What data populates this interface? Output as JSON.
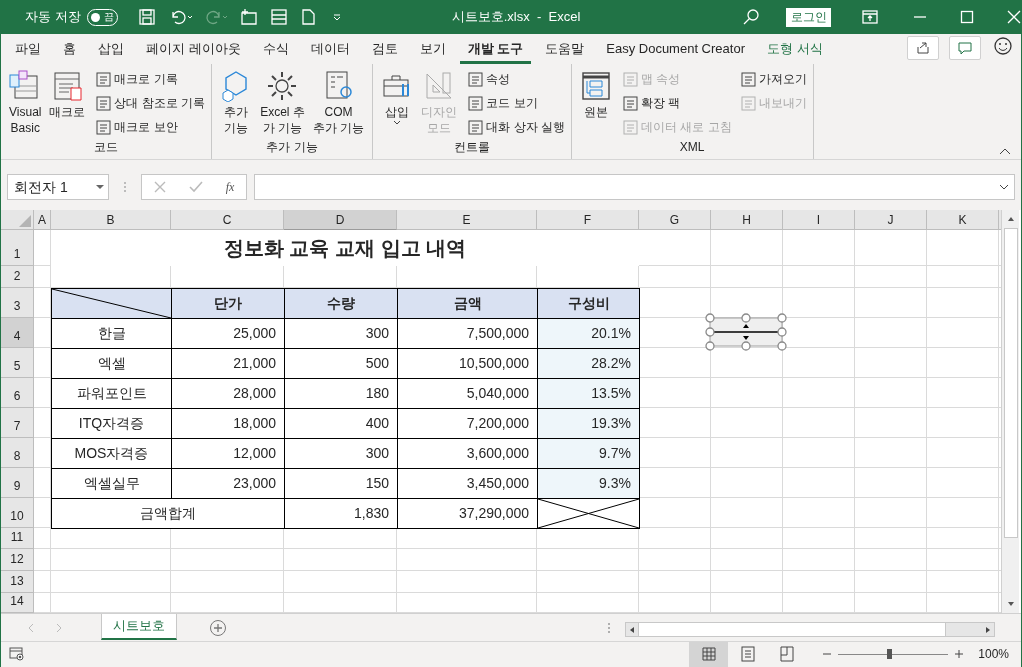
{
  "title_bar": {
    "autosave_label": "자동 저장",
    "autosave": {
      "on": false,
      "label": "끔"
    },
    "title": "시트보호.xlsx  -  Excel",
    "login_button": "로그인"
  },
  "ribbon_tabs": [
    {
      "label": "파일",
      "selected": false,
      "kind": "normal"
    },
    {
      "label": "홈",
      "selected": false,
      "kind": "normal"
    },
    {
      "label": "삽입",
      "selected": false,
      "kind": "normal"
    },
    {
      "label": "페이지 레이아웃",
      "selected": false,
      "kind": "normal"
    },
    {
      "label": "수식",
      "selected": false,
      "kind": "normal"
    },
    {
      "label": "데이터",
      "selected": false,
      "kind": "normal"
    },
    {
      "label": "검토",
      "selected": false,
      "kind": "normal"
    },
    {
      "label": "보기",
      "selected": false,
      "kind": "normal"
    },
    {
      "label": "개발 도구",
      "selected": true,
      "kind": "normal"
    },
    {
      "label": "도움말",
      "selected": false,
      "kind": "normal"
    },
    {
      "label": "Easy Document Creator",
      "selected": false,
      "kind": "normal"
    },
    {
      "label": "도형 서식",
      "selected": false,
      "kind": "contextual"
    }
  ],
  "ribbon_groups": [
    {
      "label": "코드",
      "large": [
        {
          "lines": [
            "Visual",
            "Basic"
          ],
          "disabled": false,
          "menu": false
        },
        {
          "lines": [
            "매크로"
          ],
          "disabled": false,
          "menu": false
        }
      ],
      "small_columns": [
        [
          {
            "label": "매크로 기록",
            "disabled": false
          },
          {
            "label": "상대 참조로 기록",
            "disabled": false
          },
          {
            "label": "매크로 보안",
            "disabled": false
          }
        ]
      ]
    },
    {
      "label": "추가 기능",
      "large": [
        {
          "lines": [
            "추가",
            "기능"
          ],
          "disabled": false,
          "menu": false
        },
        {
          "lines": [
            "Excel 추",
            "가 기능"
          ],
          "disabled": false,
          "menu": false
        },
        {
          "lines": [
            "COM",
            "추가 기능"
          ],
          "disabled": false,
          "menu": false
        }
      ]
    },
    {
      "label": "컨트롤",
      "large": [
        {
          "lines": [
            "삽입"
          ],
          "disabled": false,
          "menu": true
        },
        {
          "lines": [
            "디자인",
            "모드"
          ],
          "disabled": true,
          "menu": false
        }
      ],
      "small_columns": [
        [
          {
            "label": "속성",
            "disabled": false
          },
          {
            "label": "코드 보기",
            "disabled": false
          },
          {
            "label": "대화 상자 실행",
            "disabled": false
          }
        ]
      ]
    },
    {
      "label": "XML",
      "large": [
        {
          "lines": [
            "원본"
          ],
          "disabled": false,
          "menu": false
        }
      ],
      "small_columns": [
        [
          {
            "label": "맵 속성",
            "disabled": true
          },
          {
            "label": "확장 팩",
            "disabled": false
          },
          {
            "label": "데이터 새로 고침",
            "disabled": true
          }
        ],
        [
          {
            "label": "가져오기",
            "disabled": false
          },
          {
            "label": "내보내기",
            "disabled": true
          }
        ]
      ]
    }
  ],
  "formula_bar": {
    "name_box": "회전자 1",
    "function_label": "fx"
  },
  "columns": [
    {
      "label": "A",
      "selected": false
    },
    {
      "label": "B",
      "selected": false
    },
    {
      "label": "C",
      "selected": false
    },
    {
      "label": "D",
      "selected": true
    },
    {
      "label": "E",
      "selected": false
    },
    {
      "label": "F",
      "selected": false
    },
    {
      "label": "G",
      "selected": false
    },
    {
      "label": "H",
      "selected": false
    },
    {
      "label": "I",
      "selected": false
    },
    {
      "label": "J",
      "selected": false
    },
    {
      "label": "K",
      "selected": false
    }
  ],
  "rows": [
    {
      "label": "1",
      "selected": false
    },
    {
      "label": "2",
      "selected": false
    },
    {
      "label": "3",
      "selected": false
    },
    {
      "label": "4",
      "selected": true
    },
    {
      "label": "5",
      "selected": false
    },
    {
      "label": "6",
      "selected": false
    },
    {
      "label": "7",
      "selected": false
    },
    {
      "label": "8",
      "selected": false
    },
    {
      "label": "9",
      "selected": false
    },
    {
      "label": "10",
      "selected": false
    },
    {
      "label": "11",
      "selected": false
    },
    {
      "label": "12",
      "selected": false
    },
    {
      "label": "13",
      "selected": false
    },
    {
      "label": "14",
      "selected": false
    }
  ],
  "sheet": {
    "title": "정보화 교육 교재 입고 내역",
    "headers": [
      "단가",
      "수량",
      "금액",
      "구성비"
    ],
    "items": [
      {
        "name": "한글",
        "price": "25,000",
        "qty": "300",
        "amount": "7,500,000",
        "ratio": "20.1%"
      },
      {
        "name": "엑셀",
        "price": "21,000",
        "qty": "500",
        "amount": "10,500,000",
        "ratio": "28.2%"
      },
      {
        "name": "파워포인트",
        "price": "28,000",
        "qty": "180",
        "amount": "5,040,000",
        "ratio": "13.5%"
      },
      {
        "name": "ITQ자격증",
        "price": "18,000",
        "qty": "400",
        "amount": "7,200,000",
        "ratio": "19.3%"
      },
      {
        "name": "MOS자격증",
        "price": "12,000",
        "qty": "300",
        "amount": "3,600,000",
        "ratio": "9.7%"
      },
      {
        "name": "엑셀실무",
        "price": "23,000",
        "qty": "150",
        "amount": "3,450,000",
        "ratio": "9.3%"
      }
    ],
    "total": {
      "label": "금액합계",
      "qty": "1,830",
      "amount": "37,290,000"
    }
  },
  "spin_button": {
    "selected": true
  },
  "sheet_tabs": [
    {
      "label": "시트보호",
      "selected": true
    }
  ],
  "status_bar": {
    "views": [
      {
        "kind": "normal",
        "selected": true
      },
      {
        "kind": "page-layout",
        "selected": false
      },
      {
        "kind": "page-break",
        "selected": false
      }
    ],
    "zoom": {
      "level": 0.46,
      "label": "100%"
    }
  }
}
